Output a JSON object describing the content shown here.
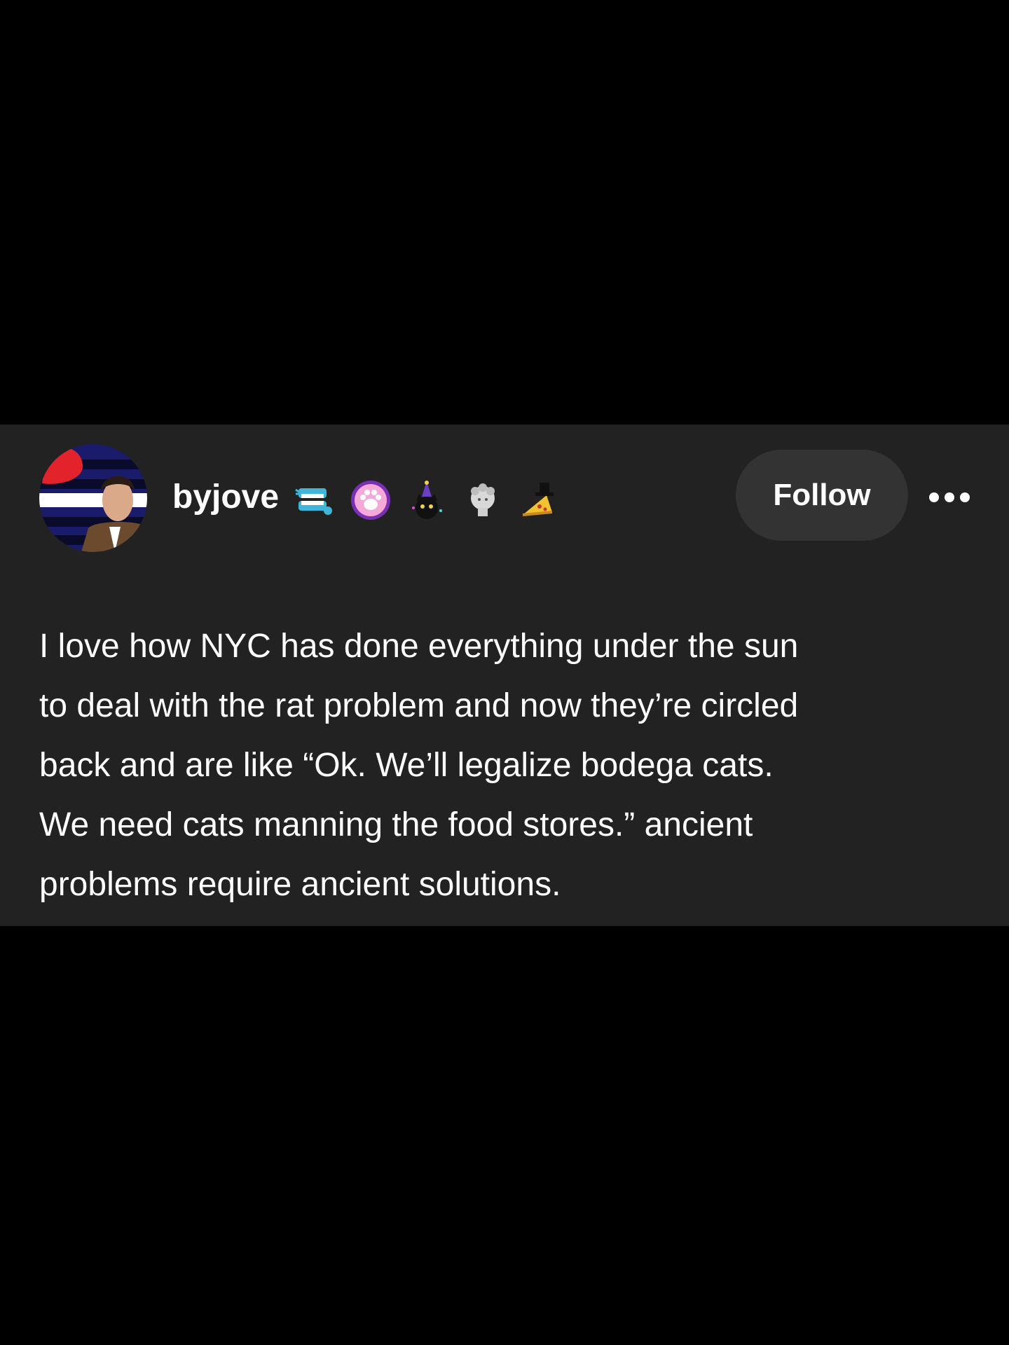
{
  "post": {
    "username": "byjove",
    "follow_label": "Follow",
    "body_text": "I love how NYC has done everything under the sun\nto deal with the rat problem and now they’re circled\nback and are like “Ok. We’ll legalize bodega cats.\nWe need cats manning the food stores.” ancient\nproblems require ancient solutions.",
    "badges": [
      "chatter-teeth-badge-icon",
      "paw-badge-icon",
      "party-cat-badge-icon",
      "statue-head-badge-icon",
      "pizza-hat-badge-icon"
    ]
  },
  "colors": {
    "page_background": "#000000",
    "card_background": "#222222",
    "follow_button_background": "#333333",
    "text": "#ffffff"
  }
}
